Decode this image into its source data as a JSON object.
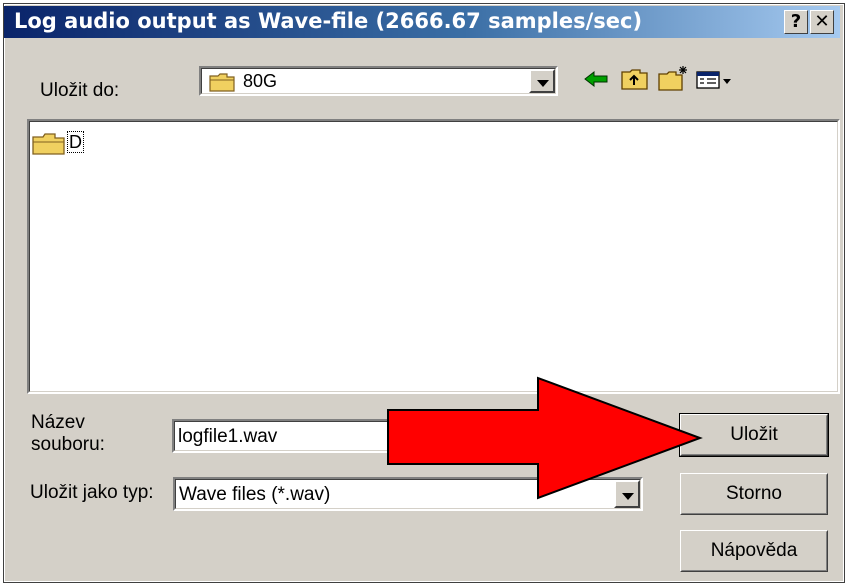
{
  "window": {
    "title": "Log audio output as Wave-file (2666.67 samples/sec)",
    "help_label": "?",
    "close_label": "✕"
  },
  "save_in": {
    "label": "Uložit do:",
    "value": "80G"
  },
  "toolbar": {
    "icons": [
      "back-arrow-icon",
      "up-folder-icon",
      "new-folder-icon",
      "view-menu-icon"
    ]
  },
  "file_list": {
    "items": [
      {
        "name": "D",
        "icon": "folder-icon"
      }
    ]
  },
  "filename": {
    "label_line1": "Název",
    "label_line2": "souboru:",
    "value": "logfile1.wav"
  },
  "filetype": {
    "label": "Uložit jako typ:",
    "value": "Wave files (*.wav)"
  },
  "buttons": {
    "save": "Uložit",
    "cancel": "Storno",
    "help": "Nápověda"
  },
  "colors": {
    "dialog_bg": "#d4d0c8",
    "title_start": "#0a246a",
    "title_end": "#a6caf0",
    "annotation_arrow": "#ff0000",
    "folder_yellow": "#f0d060"
  }
}
